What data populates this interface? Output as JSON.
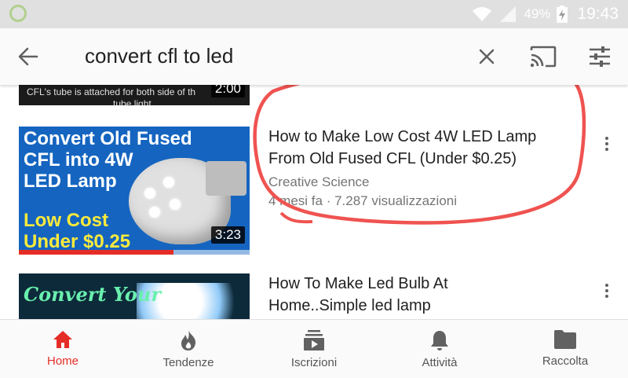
{
  "status_bar": {
    "battery_text": "49%",
    "time": "19:43"
  },
  "search": {
    "query": "convert cfl to led"
  },
  "results": {
    "previous": {
      "thumb_text_1": "CFL's tube is attached for both side of th",
      "thumb_text_2": "tube light",
      "duration": "2:00"
    },
    "items": [
      {
        "title_line1": "How to Make Low Cost 4W LED Lamp",
        "title_line2": "From Old Fused CFL (Under $0.25)",
        "channel": "Creative Science",
        "meta": "4 mesi fa · 7.287 visualizzazioni",
        "duration": "3:23",
        "watched_fraction": 0.67,
        "thumb_lines": [
          "Convert Old Fused",
          "CFL into 4W",
          "LED Lamp"
        ],
        "thumb_lines_yellow": [
          "Low Cost",
          "Under $0.25"
        ]
      },
      {
        "title_line1": "How To Make Led Bulb At",
        "title_line2": "Home..Simple led lamp",
        "thumb_text": "Convert Your"
      }
    ]
  },
  "bottom_nav": {
    "items": [
      {
        "label": "Home",
        "icon": "home-icon",
        "active": true
      },
      {
        "label": "Tendenze",
        "icon": "flame-icon",
        "active": false
      },
      {
        "label": "Iscrizioni",
        "icon": "subscriptions-icon",
        "active": false
      },
      {
        "label": "Attività",
        "icon": "bell-icon",
        "active": false
      },
      {
        "label": "Raccolta",
        "icon": "folder-icon",
        "active": false
      }
    ]
  },
  "colors": {
    "accent": "#e52d27",
    "annotation": "#ef5350",
    "thumb_blue": "#1565c0",
    "thumb_yellow": "#ffeb3b"
  }
}
